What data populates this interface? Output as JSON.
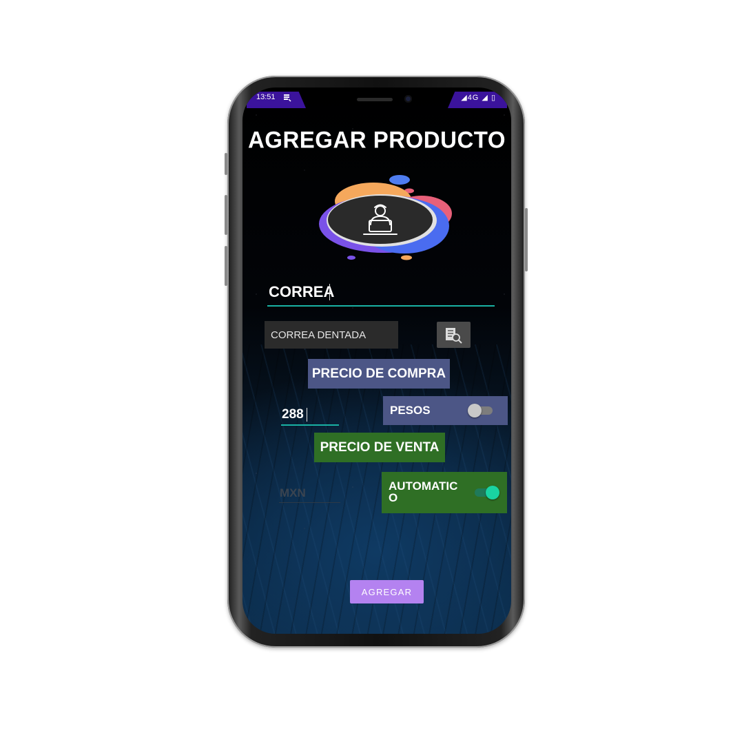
{
  "status_bar": {
    "time": "13:51",
    "right_icons": "◢4G ◢ ▯"
  },
  "screen": {
    "title": "AGREGAR PRODUCTO",
    "product_name_value": "CORREA",
    "product_select_value": "CORREA DENTADA",
    "purchase_price_label": "PRECIO DE COMPRA",
    "purchase_price_value": "288",
    "currency_toggle_label": "PESOS",
    "currency_toggle_on": false,
    "sale_price_label": "PRECIO DE VENTA",
    "sale_price_placeholder": "MXN",
    "auto_toggle_label": "AUTOMATICO",
    "auto_toggle_on": true,
    "add_button_label": "AGREGAR"
  },
  "icons": {
    "search": "search-list-icon",
    "hero": "user-at-laptop-icon"
  },
  "colors": {
    "status_bar": "#3b139c",
    "accent_teal": "#19b2a4",
    "compra_box": "#4c5686",
    "venta_box": "#2f6f25",
    "add_button": "#b482f0"
  }
}
